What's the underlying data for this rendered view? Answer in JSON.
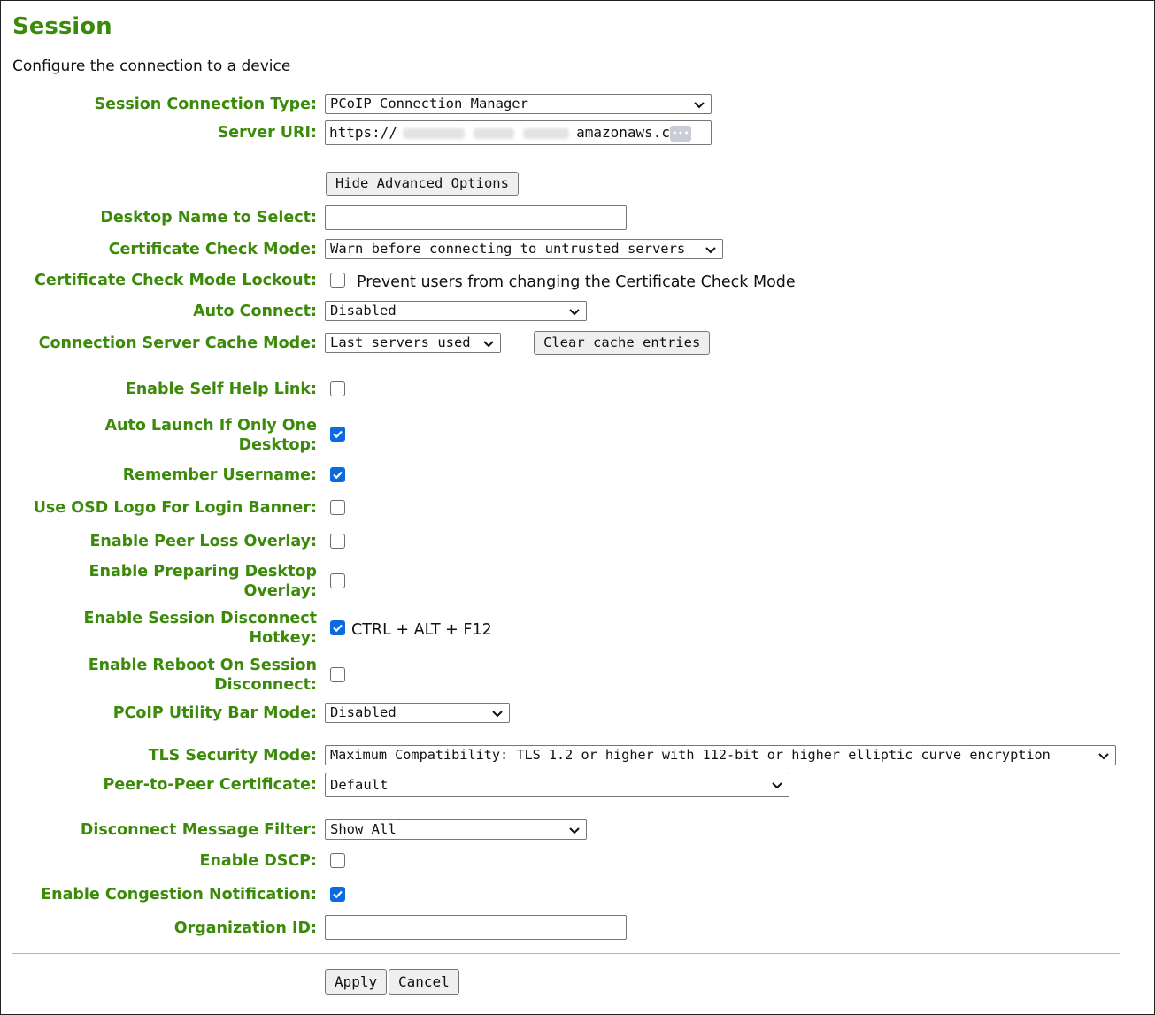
{
  "page": {
    "title": "Session",
    "subtitle": "Configure the connection to a device"
  },
  "fields": {
    "session_connection_type": {
      "label": "Session Connection Type:",
      "value": "PCoIP Connection Manager"
    },
    "server_uri": {
      "label": "Server URI:",
      "value_prefix": "https://",
      "value_suffix": "amazonaws.c",
      "overflow_indicator": "•••"
    },
    "hide_advanced_button": "Hide Advanced Options",
    "desktop_name": {
      "label": "Desktop Name to Select:",
      "value": ""
    },
    "cert_check_mode": {
      "label": "Certificate Check Mode:",
      "value": "Warn before connecting to untrusted servers"
    },
    "cert_lockout": {
      "label": "Certificate Check Mode Lockout:",
      "checkbox_text": "Prevent users from changing the Certificate Check Mode",
      "checked": false
    },
    "auto_connect": {
      "label": "Auto Connect:",
      "value": "Disabled"
    },
    "cache_mode": {
      "label": "Connection Server Cache Mode:",
      "value": "Last servers used",
      "clear_button": "Clear cache entries"
    },
    "self_help": {
      "label": "Enable Self Help Link:",
      "checked": false
    },
    "auto_launch": {
      "label": "Auto Launch If Only One Desktop:",
      "checked": true
    },
    "remember_username": {
      "label": "Remember Username:",
      "checked": true
    },
    "osd_logo": {
      "label": "Use OSD Logo For Login Banner:",
      "checked": false
    },
    "peer_loss": {
      "label": "Enable Peer Loss Overlay:",
      "checked": false
    },
    "preparing_desktop": {
      "label": "Enable Preparing Desktop Overlay:",
      "checked": false
    },
    "disconnect_hotkey": {
      "label": "Enable Session Disconnect Hotkey:",
      "checked": true,
      "hotkey_text": "CTRL + ALT + F12"
    },
    "reboot_on_disconnect": {
      "label": "Enable Reboot On Session Disconnect:",
      "checked": false
    },
    "utility_bar": {
      "label": "PCoIP Utility Bar Mode:",
      "value": "Disabled"
    },
    "tls_mode": {
      "label": "TLS Security Mode:",
      "value": "Maximum Compatibility: TLS 1.2 or higher with 112-bit or higher elliptic curve encryption"
    },
    "p2p_cert": {
      "label": "Peer-to-Peer Certificate:",
      "value": "Default"
    },
    "disconnect_filter": {
      "label": "Disconnect Message Filter:",
      "value": "Show All"
    },
    "dscp": {
      "label": "Enable DSCP:",
      "checked": false
    },
    "congestion": {
      "label": "Enable Congestion Notification:",
      "checked": true
    },
    "org_id": {
      "label": "Organization ID:",
      "value": ""
    }
  },
  "actions": {
    "apply": "Apply",
    "cancel": "Cancel"
  },
  "colors": {
    "label_green": "#3b8a0a",
    "checkbox_blue": "#0b6ae0"
  }
}
